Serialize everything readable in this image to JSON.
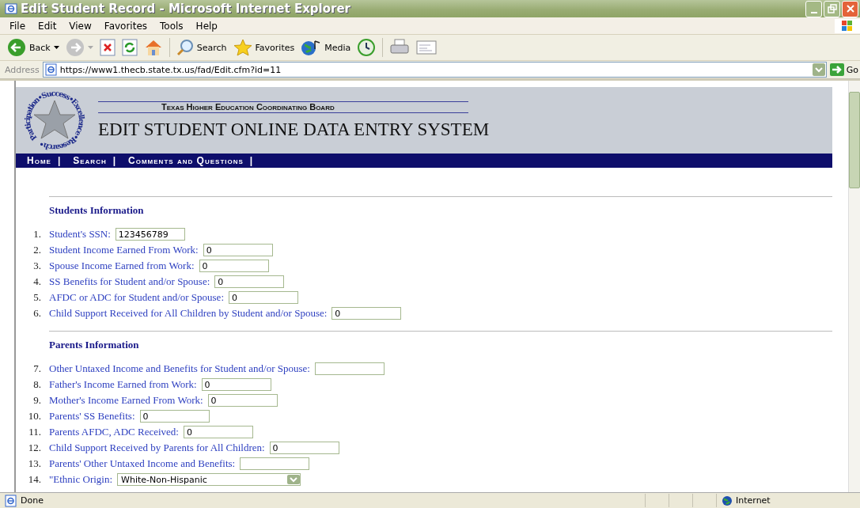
{
  "window": {
    "title": "Edit Student Record - Microsoft Internet Explorer"
  },
  "menu": [
    "File",
    "Edit",
    "View",
    "Favorites",
    "Tools",
    "Help"
  ],
  "toolbar": [
    {
      "kind": "back",
      "label": "Back"
    },
    {
      "kind": "forward"
    },
    {
      "kind": "stop"
    },
    {
      "kind": "refresh"
    },
    {
      "kind": "home"
    },
    {
      "kind": "search",
      "label": "Search"
    },
    {
      "kind": "favorites",
      "label": "Favorites"
    },
    {
      "kind": "media",
      "label": "Media"
    },
    {
      "kind": "history"
    },
    {
      "kind": "print"
    },
    {
      "kind": "edit"
    }
  ],
  "address": {
    "label": "Address",
    "url": "https://www1.thecb.state.tx.us/fad/Edit.cfm?id=11",
    "go": "Go"
  },
  "banner": {
    "seal_text": "Participation•Success•Excellence•Research•",
    "org": "Texas Higher Education Coordinating Board",
    "title": "EDIT STUDENT ONLINE DATA ENTRY SYSTEM"
  },
  "nav": [
    {
      "label": "Home",
      "separator": "|"
    },
    {
      "label": "Search",
      "separator": "|"
    },
    {
      "label": "Comments and Questions",
      "separator": "|"
    }
  ],
  "sections": [
    {
      "heading": "Students Information",
      "fields": [
        {
          "number": "1.",
          "label": "Student's SSN:",
          "kind": "text",
          "value": "123456789"
        },
        {
          "number": "2.",
          "label": "Student Income Earned From Work:",
          "kind": "text",
          "value": "0"
        },
        {
          "number": "3.",
          "label": "Spouse Income Earned from Work:",
          "kind": "text",
          "value": "0"
        },
        {
          "number": "4.",
          "label": "SS Benefits for Student and/or Spouse:",
          "kind": "text",
          "value": "0"
        },
        {
          "number": "5.",
          "label": "AFDC or ADC for Student and/or Spouse:",
          "kind": "text",
          "value": "0"
        },
        {
          "number": "6.",
          "label": "Child Support Received for All Children by Student and/or Spouse:",
          "kind": "text",
          "value": "0"
        }
      ]
    },
    {
      "heading": "Parents Information",
      "fields": [
        {
          "number": "7.",
          "label": "Other Untaxed Income and Benefits for Student and/or Spouse:",
          "kind": "text"
        },
        {
          "number": "8.",
          "label": "Father's Income Earned from Work:",
          "kind": "text",
          "value": "0"
        },
        {
          "number": "9.",
          "label": "Mother's Income Earned From Work:",
          "kind": "text",
          "value": "0"
        },
        {
          "number": "10.",
          "label": "Parents' SS Benefits:",
          "kind": "text",
          "value": "0"
        },
        {
          "number": "11.",
          "label": "Parents AFDC, ADC Received:",
          "kind": "text",
          "value": "0"
        },
        {
          "number": "12.",
          "label": "Child Support Received by Parents for All Children:",
          "kind": "text",
          "value": "0"
        },
        {
          "number": "13.",
          "label": "Parents' Other Untaxed Income and Benefits:",
          "kind": "text"
        },
        {
          "number": "14.",
          "label": "\"Ethnic Origin:",
          "kind": "select",
          "value": "White-Non-Hispanic"
        }
      ]
    }
  ],
  "status_bar": {
    "text": "Done",
    "zone": "Internet"
  }
}
